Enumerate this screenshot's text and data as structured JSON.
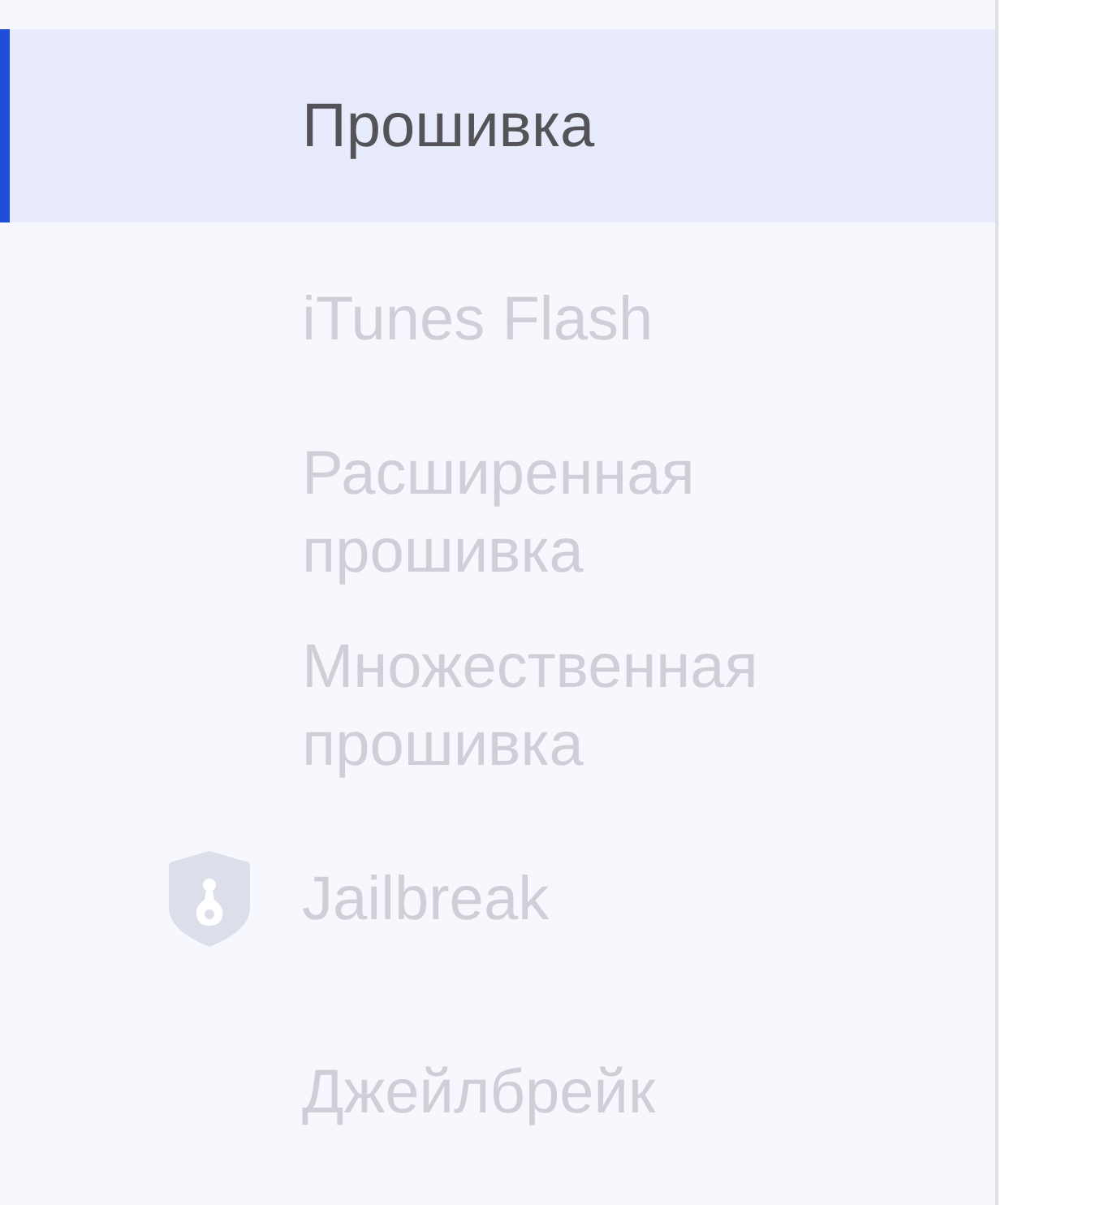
{
  "sidebar": {
    "items": [
      {
        "label": "Прошивка",
        "kind": "plain",
        "selected": true
      },
      {
        "label": "iTunes Flash",
        "kind": "plain",
        "selected": false
      },
      {
        "label": "Расширенная прошивка",
        "kind": "plain",
        "selected": false
      },
      {
        "label": "Множественная прошивка",
        "kind": "plain",
        "selected": false
      },
      {
        "label": "Jailbreak",
        "kind": "icon",
        "selected": false
      },
      {
        "label": "Джейлбрейк",
        "kind": "plain",
        "selected": false
      }
    ]
  }
}
